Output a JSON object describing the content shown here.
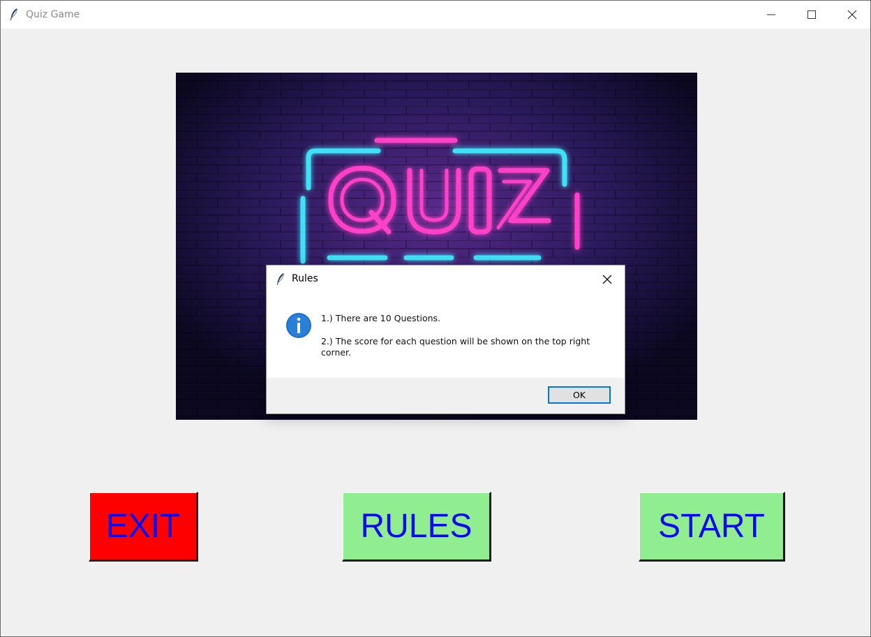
{
  "window": {
    "title": "Quiz Game",
    "controls": [
      "minimize-icon",
      "maximize-icon",
      "close-icon"
    ]
  },
  "banner": {
    "neon_text": "QUIZ",
    "colors": {
      "pink": "#ff3fc8",
      "cyan": "#3fe0f7",
      "wall": "#1a1036"
    }
  },
  "buttons": {
    "exit": {
      "label": "EXIT",
      "color": "#ff0000"
    },
    "rules": {
      "label": "RULES",
      "color": "#90ee90"
    },
    "start": {
      "label": "START",
      "color": "#90ee90"
    },
    "text_color": "#0a0af0"
  },
  "dialog": {
    "title": "Rules",
    "icon": "info-icon",
    "line1": "1.) There are 10 Questions.",
    "line2": "2.) The score for each question will be shown on the top right corner.",
    "ok_label": "OK"
  }
}
